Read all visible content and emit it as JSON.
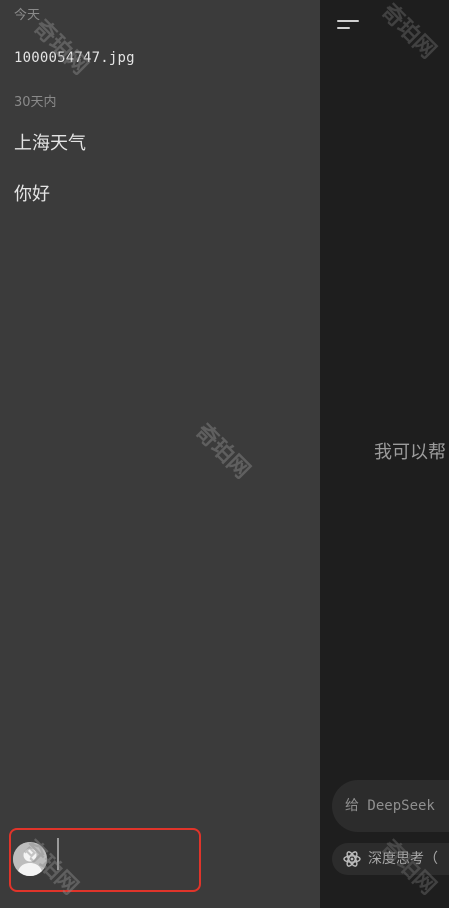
{
  "sidebar": {
    "sections": [
      {
        "label": "今天",
        "items": [
          {
            "label": "1000054747.jpg"
          }
        ]
      },
      {
        "label": "30天内",
        "items": [
          {
            "label": "上海天气"
          },
          {
            "label": "你好"
          }
        ]
      }
    ],
    "user": {
      "avatar_icon": "user-avatar-icon",
      "highlight_color": "#e0342a"
    }
  },
  "main": {
    "menu_icon": "menu-icon",
    "welcome_text": "我可以帮",
    "input": {
      "placeholder": "给 DeepSeek"
    },
    "deep_think": {
      "label": "深度思考（",
      "icon": "atom-icon"
    }
  },
  "watermark": {
    "text": "奇珀网"
  },
  "colors": {
    "sidebar_bg": "#3b3b3b",
    "main_bg": "#1e1e1e",
    "pill_bg": "#2c2c2c",
    "highlight": "#e0342a"
  }
}
